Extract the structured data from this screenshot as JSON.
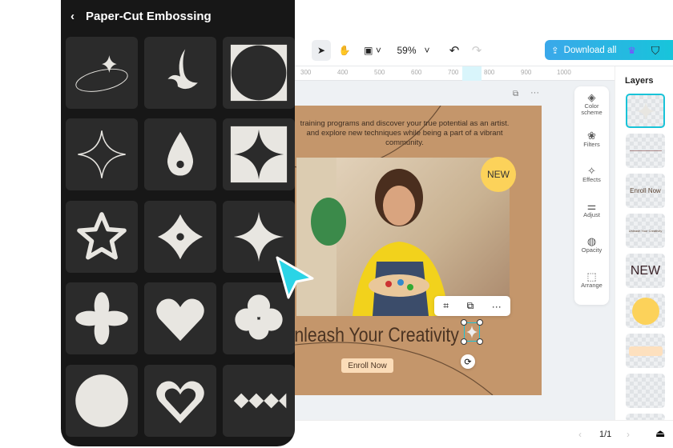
{
  "panel": {
    "title": "Paper-Cut Embossing"
  },
  "toolbar": {
    "zoom": "59%",
    "download_label": "Download all"
  },
  "ruler": [
    "300",
    "400",
    "500",
    "600",
    "700",
    "800",
    "900",
    "1000"
  ],
  "design": {
    "body_text_1": "training programs and discover your true potential as an artist.",
    "body_text_2": "and explore new techniques while being a part of a vibrant",
    "body_text_3": "community.",
    "badge": "NEW",
    "headline": "Unleash Your Creativity",
    "button": "Enroll Now"
  },
  "tools": [
    {
      "label": "Color scheme"
    },
    {
      "label": "Filters"
    },
    {
      "label": "Effects"
    },
    {
      "label": "Adjust"
    },
    {
      "label": "Opacity"
    },
    {
      "label": "Arrange"
    }
  ],
  "layers": {
    "title": "Layers",
    "enroll": "Enroll Now",
    "headline": "Unleash Your Creativity",
    "new": "NEW"
  },
  "pagination": {
    "page": "1/1"
  },
  "colors": {
    "accent": "#14c7d9",
    "card": "#c4966b",
    "badge": "#fcd25a",
    "shape": "#e8e6e1"
  }
}
